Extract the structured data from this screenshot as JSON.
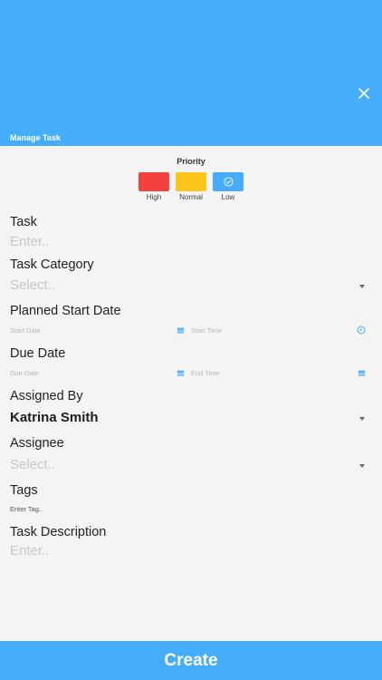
{
  "header": {
    "title": "Manage Task",
    "close_icon": "close-icon",
    "color": "#45adfb"
  },
  "priority": {
    "title": "Priority",
    "options": [
      {
        "label": "High",
        "color": "#f2413f",
        "selected": false
      },
      {
        "label": "Normal",
        "color": "#fbc51b",
        "selected": false
      },
      {
        "label": "Low",
        "color": "#45adfb",
        "selected": true
      }
    ]
  },
  "task": {
    "label": "Task",
    "placeholder": "Enter.."
  },
  "task_category": {
    "label": "Task Category",
    "placeholder": "Select.."
  },
  "planned_start": {
    "label": "Planned Start Date",
    "date_placeholder": "Start Date",
    "time_placeholder": "Start Time"
  },
  "due": {
    "label": "Due Date",
    "date_placeholder": "Due Date",
    "time_placeholder": "End Time"
  },
  "assigned_by": {
    "label": "Assigned By",
    "value": "Katrina Smith"
  },
  "assignee": {
    "label": "Assignee",
    "placeholder": "Select.."
  },
  "tags": {
    "label": "Tags",
    "placeholder": "Enter Tag.."
  },
  "description": {
    "label": "Task Description",
    "placeholder": "Enter.."
  },
  "create_button": {
    "label": "Create"
  }
}
